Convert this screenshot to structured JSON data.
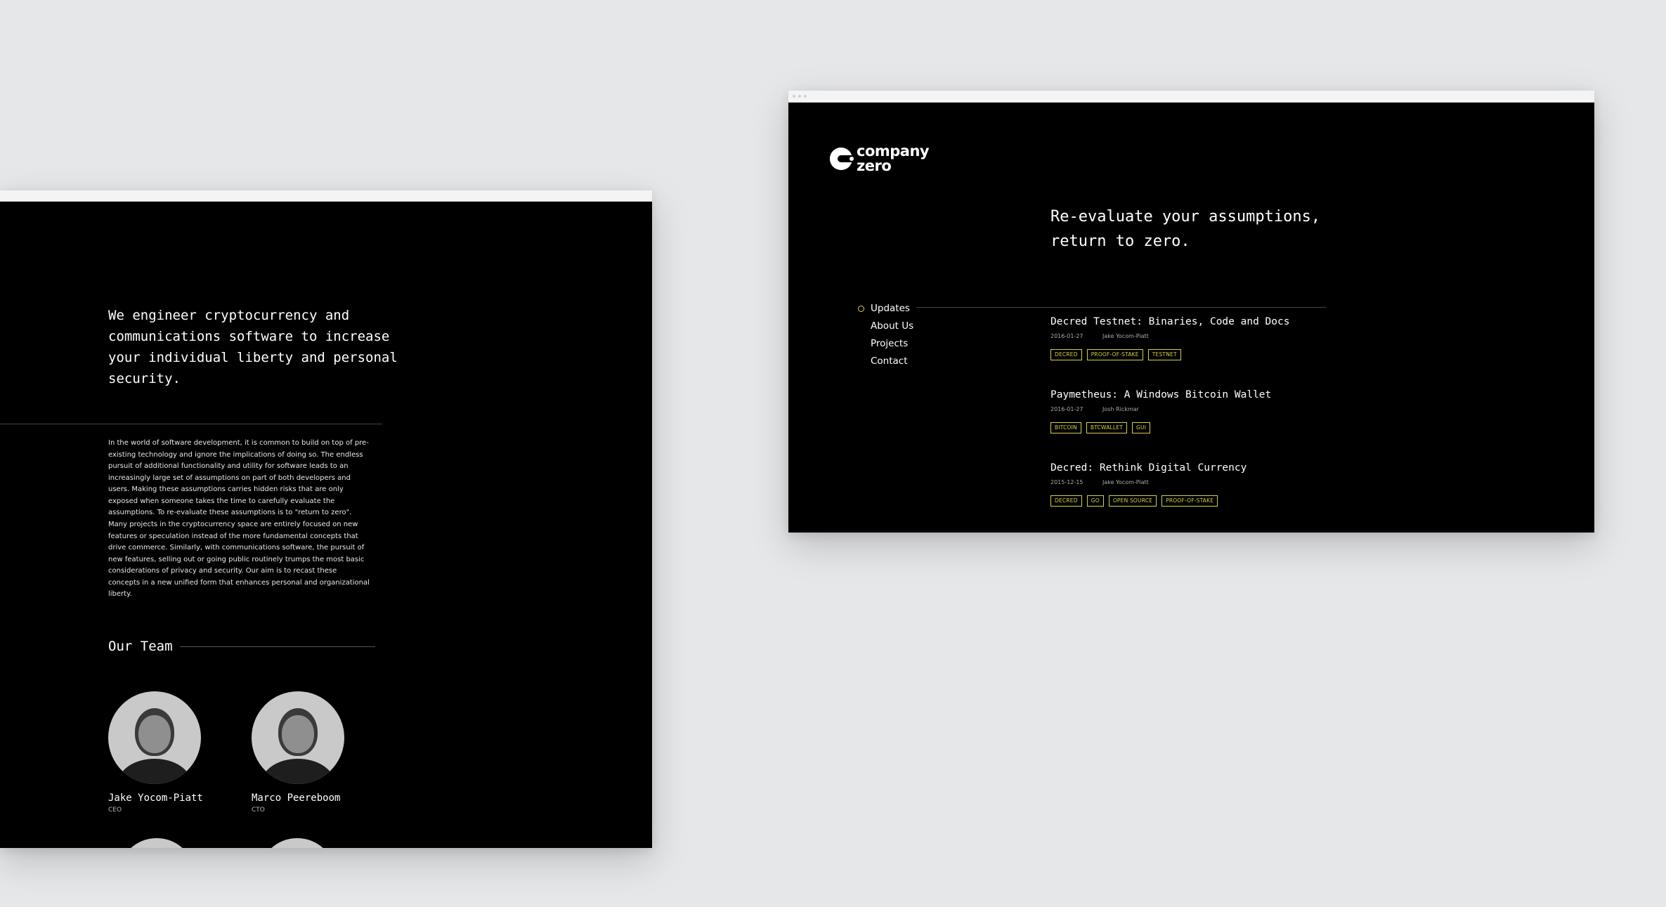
{
  "about_window": {
    "lead": "We engineer cryptocurrency and communications software to increase your individual liberty and personal security.",
    "paragraphs": [
      "In the world of software development, it is common to build on top of pre-existing technology and ignore the implications of doing so. The endless pursuit of additional functionality and utility for software leads to an increasingly large set of assumptions on part of both developers and users. Making these assumptions carries hidden risks that are only exposed when someone takes the time to carefully evaluate the assumptions. To re-evaluate these assumptions is to \"return to zero\".",
      "Many projects in the cryptocurrency space are entirely focused on new features or speculation instead of the more fundamental concepts that drive commerce. Similarly, with communications software, the pursuit of new features, selling out or going public routinely trumps the most basic considerations of privacy and security. Our aim is to recast these concepts in a new unified form that enhances personal and organizational liberty."
    ],
    "team_heading": "Our Team",
    "team": [
      {
        "name": "Jake Yocom-Piatt",
        "role": "CEO"
      },
      {
        "name": "Marco Peereboom",
        "role": "CTO"
      }
    ]
  },
  "home_window": {
    "logo": {
      "line1": "company",
      "line2": "zero"
    },
    "tagline_line1": "Re-evaluate your assumptions,",
    "tagline_line2": "return to zero.",
    "nav": [
      {
        "label": "Updates",
        "active": true
      },
      {
        "label": "About Us",
        "active": false
      },
      {
        "label": "Projects",
        "active": false
      },
      {
        "label": "Contact",
        "active": false
      }
    ],
    "posts": [
      {
        "title": "Decred Testnet: Binaries, Code and Docs",
        "date": "2016-01-27",
        "author": "Jake Yocom-Piatt",
        "tags": [
          "DECRED",
          "PROOF-OF-STAKE",
          "TESTNET"
        ]
      },
      {
        "title": "Paymetheus: A Windows Bitcoin Wallet",
        "date": "2016-01-27",
        "author": "Josh Rickmar",
        "tags": [
          "BITCOIN",
          "BTCWALLET",
          "GUI"
        ]
      },
      {
        "title": "Decred: Rethink Digital Currency",
        "date": "2015-12-15",
        "author": "Jake Yocom-Piatt",
        "tags": [
          "DECRED",
          "GO",
          "OPEN SOURCE",
          "PROOF-OF-STAKE"
        ]
      }
    ]
  },
  "colors": {
    "background": "#e6e7e9",
    "window": "#000000",
    "accent": "#d6d243",
    "text": "#ffffff"
  },
  "icons": [
    "company-zero-logo-icon",
    "bullet-circle-icon"
  ]
}
